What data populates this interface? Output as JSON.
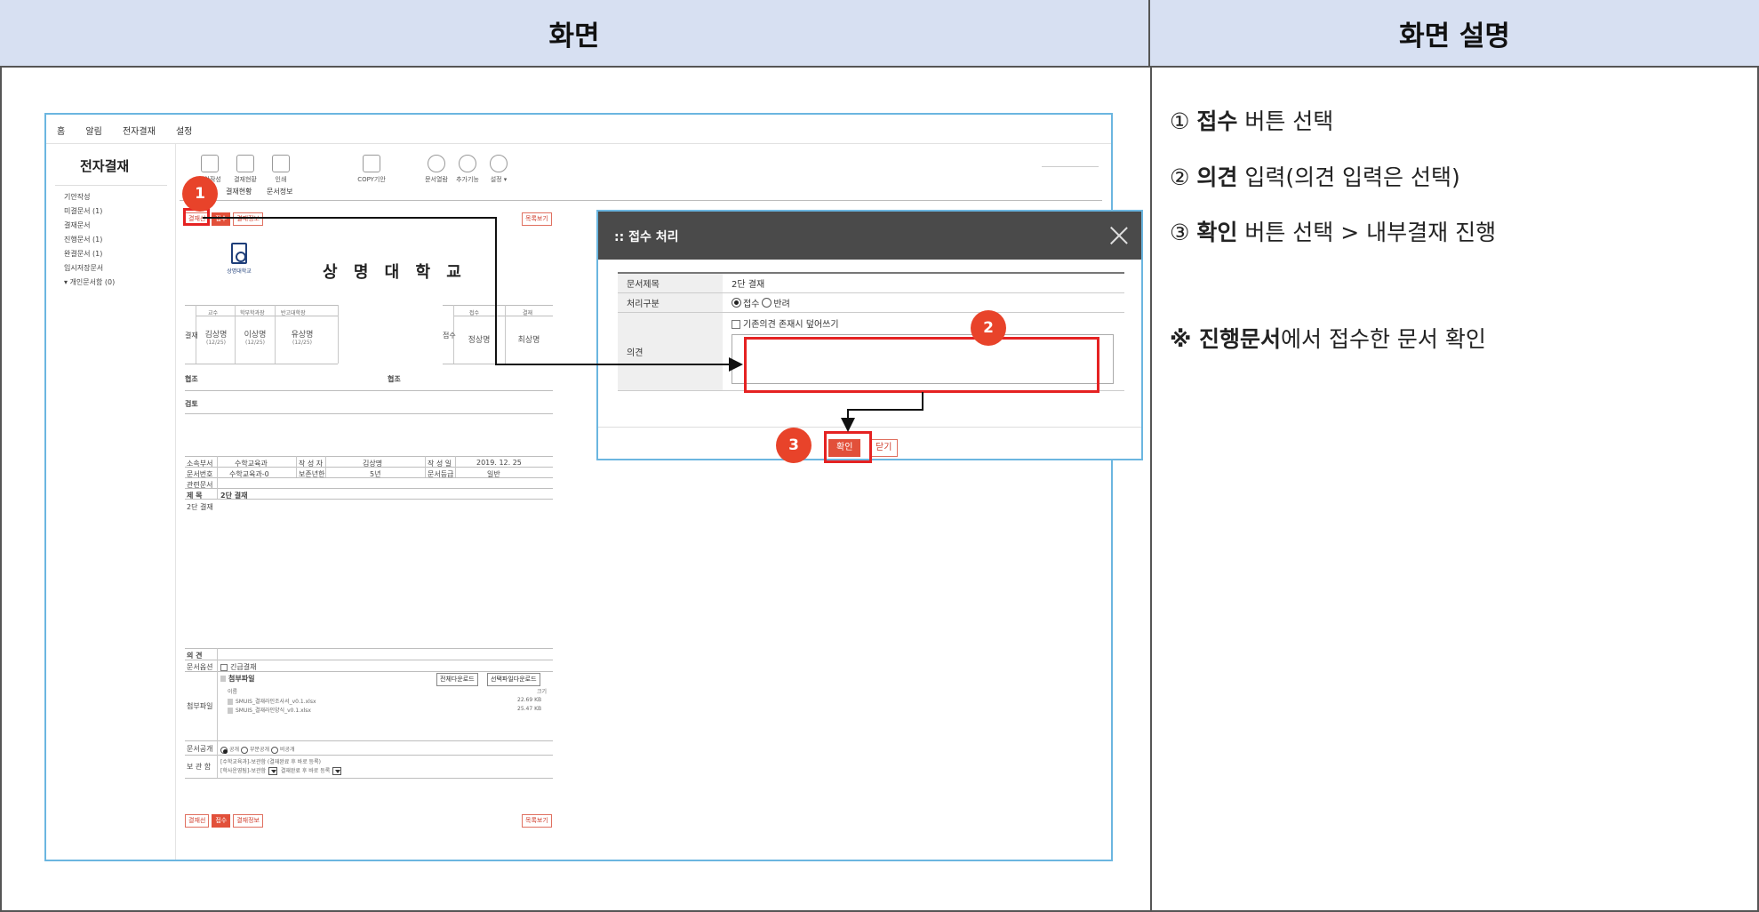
{
  "header": {
    "left_title": "화면",
    "right_title": "화면 설명"
  },
  "description": {
    "step1": {
      "num": "①",
      "bold": "접수",
      "rest": " 버튼 선택"
    },
    "step2": {
      "num": "②",
      "bold": "의견",
      "rest": " 입력(의견 입력은 선택)"
    },
    "step3": {
      "num": "③",
      "bold": "확인",
      "rest": " 버튼 선택 > 내부결재 진행"
    },
    "note": {
      "prefix": "※ ",
      "bold": "진행문서",
      "rest": "에서 접수한 문서 확인"
    }
  },
  "app": {
    "topnav": [
      "홈",
      "알림",
      "전자결재",
      "설정"
    ],
    "sidebar_title": "전자결재",
    "sidebar_items": [
      "기안작성",
      "미결문서 (1)",
      "결재문서",
      "진행문서 (1)",
      "완결문서 (1)",
      "임시저장문서",
      "▾ 개인문서함 (0)"
    ],
    "toolbar": [
      "기안작성",
      "결재현황",
      "인쇄",
      "",
      "COPY기안",
      "",
      "문서열람",
      "추가기능",
      "설정 ▾"
    ],
    "tabs": [
      "결재현황",
      "문서정보"
    ],
    "buttons_top": [
      "결재선",
      "접수",
      "결재정보"
    ],
    "button_list": "목록보기",
    "document": {
      "logo_text": "상명대학교",
      "university": "상 명 대 학 교",
      "approval_label": "결재",
      "approval_heads": [
        "교수",
        "학부학과장",
        "반고대학장"
      ],
      "approvers": [
        {
          "name": "김상명",
          "date": "(12/25)"
        },
        {
          "name": "이상명",
          "date": "(12/25)"
        },
        {
          "name": "유상명",
          "date": "(12/25)"
        }
      ],
      "receipt_label": "접수",
      "receipt_heads": [
        "접수",
        "결재"
      ],
      "receivers": [
        "정상명",
        "최상명"
      ],
      "coop_label": "협조",
      "review_label": "검토",
      "dept_label": "소속부서",
      "dept_value": "수학교육과",
      "author_label": "작 성 자",
      "author_value": "김상명",
      "date_label": "작 성 일",
      "date_value": "2019. 12. 25",
      "docno_label": "문서번호",
      "docno_value": "수학교육과-0",
      "retention_label": "보존년한",
      "retention_value": "5년",
      "grade_label": "문서등급",
      "grade_value": "일반",
      "related_label": "관련문서",
      "subject_label": "제   목",
      "subject_value": "2단 결재",
      "body_text": "2단 결재",
      "opinion_label": "의   견",
      "options_label": "문서옵션",
      "urgent_label": "긴급결재",
      "attach_label": "첨부파일",
      "attach_title": "첨부파일",
      "attach_all_btn": "전체다운로드",
      "attach_sel_btn": "선택파일다운로드",
      "attach_col_name": "이름",
      "attach_col_size": "크기",
      "files": [
        {
          "name": "SMUIS_결재라인조사서_v0.1.xlsx",
          "size": "22.69 KB"
        },
        {
          "name": "SMUIS_결재라인양식_v0.1.xlsx",
          "size": "25.47 KB"
        }
      ],
      "disclosure_label": "문서공개",
      "disclosure_options": [
        "공개",
        "부분공개",
        "비공개"
      ],
      "archive_label": "보 관 함",
      "archive_line1": "[수학교육과]-보관함  (결재완료 후 바로 등록)",
      "archive_select1": "[학사운영팀]-보관함",
      "archive_select2": "결재완료 후 바로 등록"
    },
    "buttons_bottom": [
      "결재선",
      "접수",
      "결재정보"
    ]
  },
  "dialog": {
    "title": "접수 처리",
    "doc_title_label": "문서제목",
    "doc_title_value": "2단 결재",
    "process_label": "처리구분",
    "process_options": [
      "접수",
      "반려"
    ],
    "process_selected": "접수",
    "opinion_label": "의견",
    "overwrite_label": "기존의견 존재시 덮어쓰기",
    "confirm_label": "확인",
    "close_label": "닫기"
  },
  "annotations": {
    "badge1": "1",
    "badge2": "2",
    "badge3": "3"
  },
  "colors": {
    "accent": "#e8432a",
    "header_bg": "#d7e0f2",
    "dialog_head": "#4a4a4a",
    "highlight": "#e52222"
  }
}
